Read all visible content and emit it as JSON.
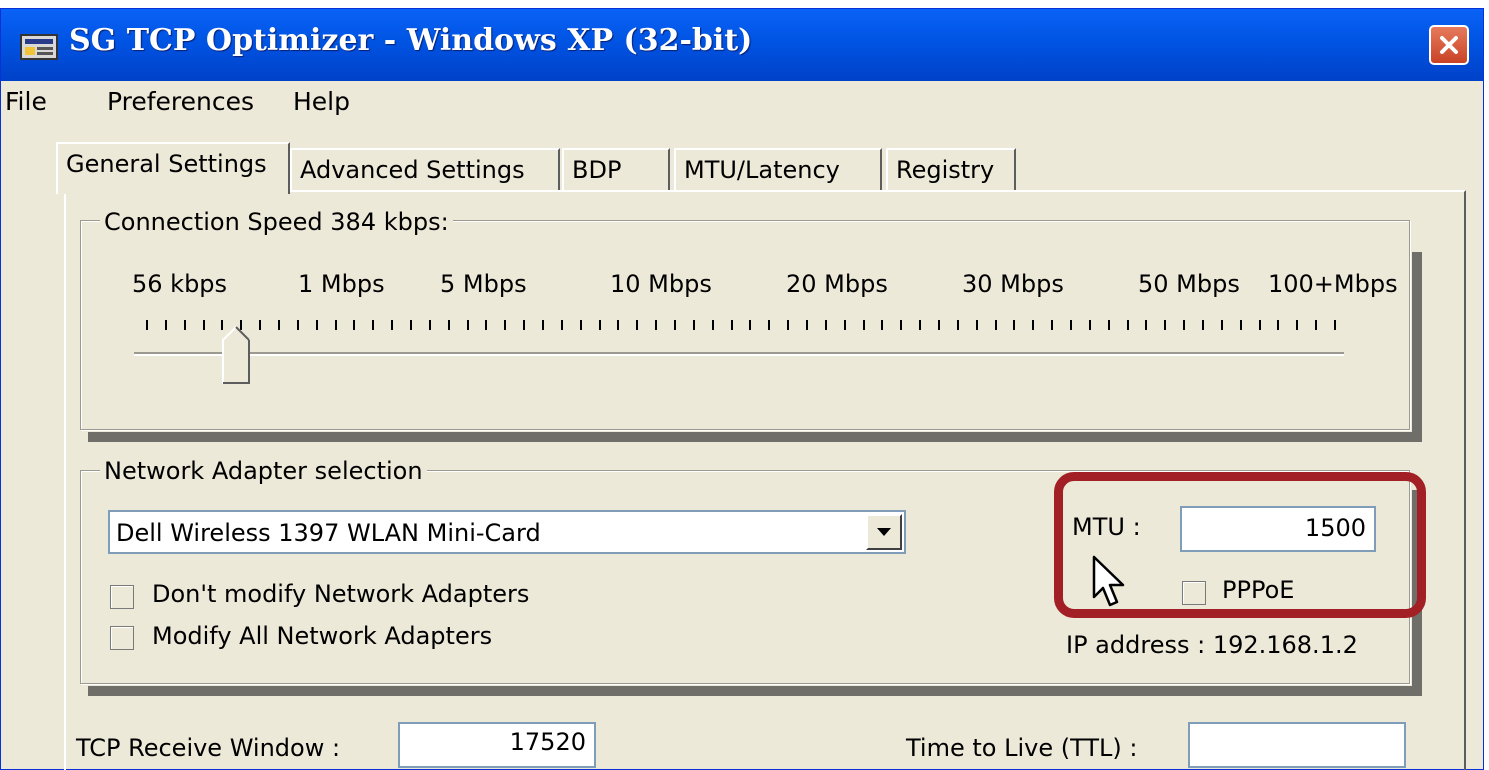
{
  "window": {
    "title": "SG TCP Optimizer - Windows XP (32-bit)"
  },
  "menu": [
    "File",
    "Preferences",
    "Help"
  ],
  "tabs": [
    "General Settings",
    "Advanced Settings",
    "BDP",
    "MTU/Latency",
    "Registry"
  ],
  "active_tab": "General Settings",
  "connection_speed": {
    "title": "Connection Speed  384 kbps:",
    "tick_labels": [
      "56 kbps",
      "1 Mbps",
      "5 Mbps",
      "10 Mbps",
      "20 Mbps",
      "30 Mbps",
      "50 Mbps",
      "100+Mbps"
    ],
    "slider_value": "384 kbps"
  },
  "network_adapter": {
    "title": "Network Adapter selection",
    "selected": "Dell Wireless 1397 WLAN Mini-Card",
    "dont_modify_label": "Don't modify Network Adapters",
    "dont_modify_checked": false,
    "modify_all_label": "Modify All Network Adapters",
    "modify_all_checked": false,
    "mtu_label": "MTU :",
    "mtu_value": "1500",
    "pppoe_label": "PPPoE",
    "pppoe_checked": false,
    "ip_address": "IP address : 192.168.1.2"
  },
  "bottom": {
    "tcp_receive_window_label": "TCP Receive Window :",
    "tcp_receive_window_value": "17520",
    "ttl_label": "Time to Live (TTL) :",
    "ttl_value": ""
  },
  "highlight_color": "#a11f25"
}
